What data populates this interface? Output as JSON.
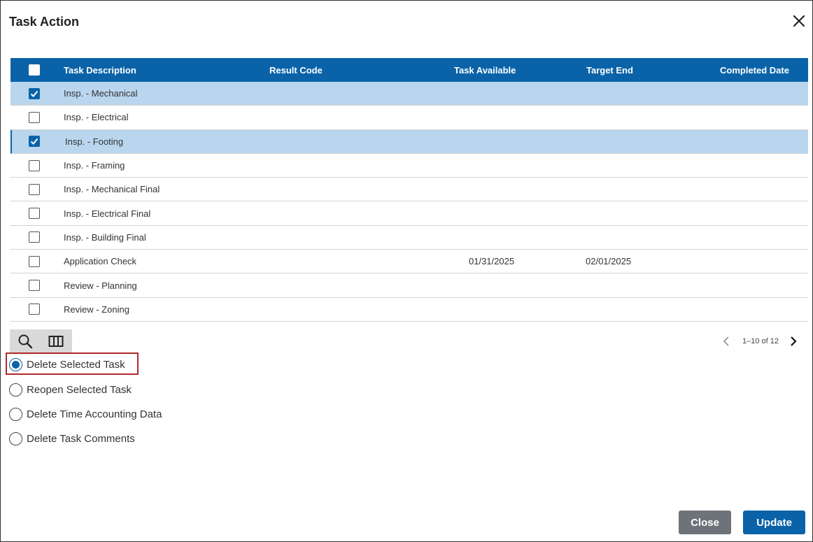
{
  "dialog": {
    "title": "Task Action"
  },
  "grid": {
    "columns": {
      "description": "Task Description",
      "result": "Result Code",
      "available": "Task Available",
      "target": "Target End",
      "completed": "Completed Date"
    },
    "rows": [
      {
        "description": "Insp. - Mechanical",
        "available": "",
        "target": "",
        "checked": true
      },
      {
        "description": "Insp. - Electrical",
        "available": "",
        "target": "",
        "checked": false
      },
      {
        "description": "Insp. - Footing",
        "available": "",
        "target": "",
        "checked": true
      },
      {
        "description": "Insp. - Framing",
        "available": "",
        "target": "",
        "checked": false
      },
      {
        "description": "Insp. - Mechanical Final",
        "available": "",
        "target": "",
        "checked": false
      },
      {
        "description": "Insp. - Electrical Final",
        "available": "",
        "target": "",
        "checked": false
      },
      {
        "description": "Insp. - Building Final",
        "available": "",
        "target": "",
        "checked": false
      },
      {
        "description": "Application Check",
        "available": "01/31/2025",
        "target": "02/01/2025",
        "checked": false
      },
      {
        "description": "Review - Planning",
        "available": "",
        "target": "",
        "checked": false
      },
      {
        "description": "Review - Zoning",
        "available": "",
        "target": "",
        "checked": false
      }
    ]
  },
  "pager": {
    "label": "1–10 of 12"
  },
  "options": [
    {
      "label": "Delete Selected Task",
      "selected": true
    },
    {
      "label": "Reopen Selected Task",
      "selected": false
    },
    {
      "label": "Delete Time Accounting Data",
      "selected": false
    },
    {
      "label": "Delete Task Comments",
      "selected": false
    }
  ],
  "buttons": {
    "close": "Close",
    "update": "Update"
  },
  "colors": {
    "accent": "#0a63a8",
    "selected_row": "#b9d6ee",
    "highlight": "#b02a2a",
    "close_button": "#6e7379"
  },
  "icons": [
    "close-icon",
    "search-icon",
    "columns-icon",
    "chevron-left-icon",
    "chevron-right-icon",
    "check-icon"
  ]
}
